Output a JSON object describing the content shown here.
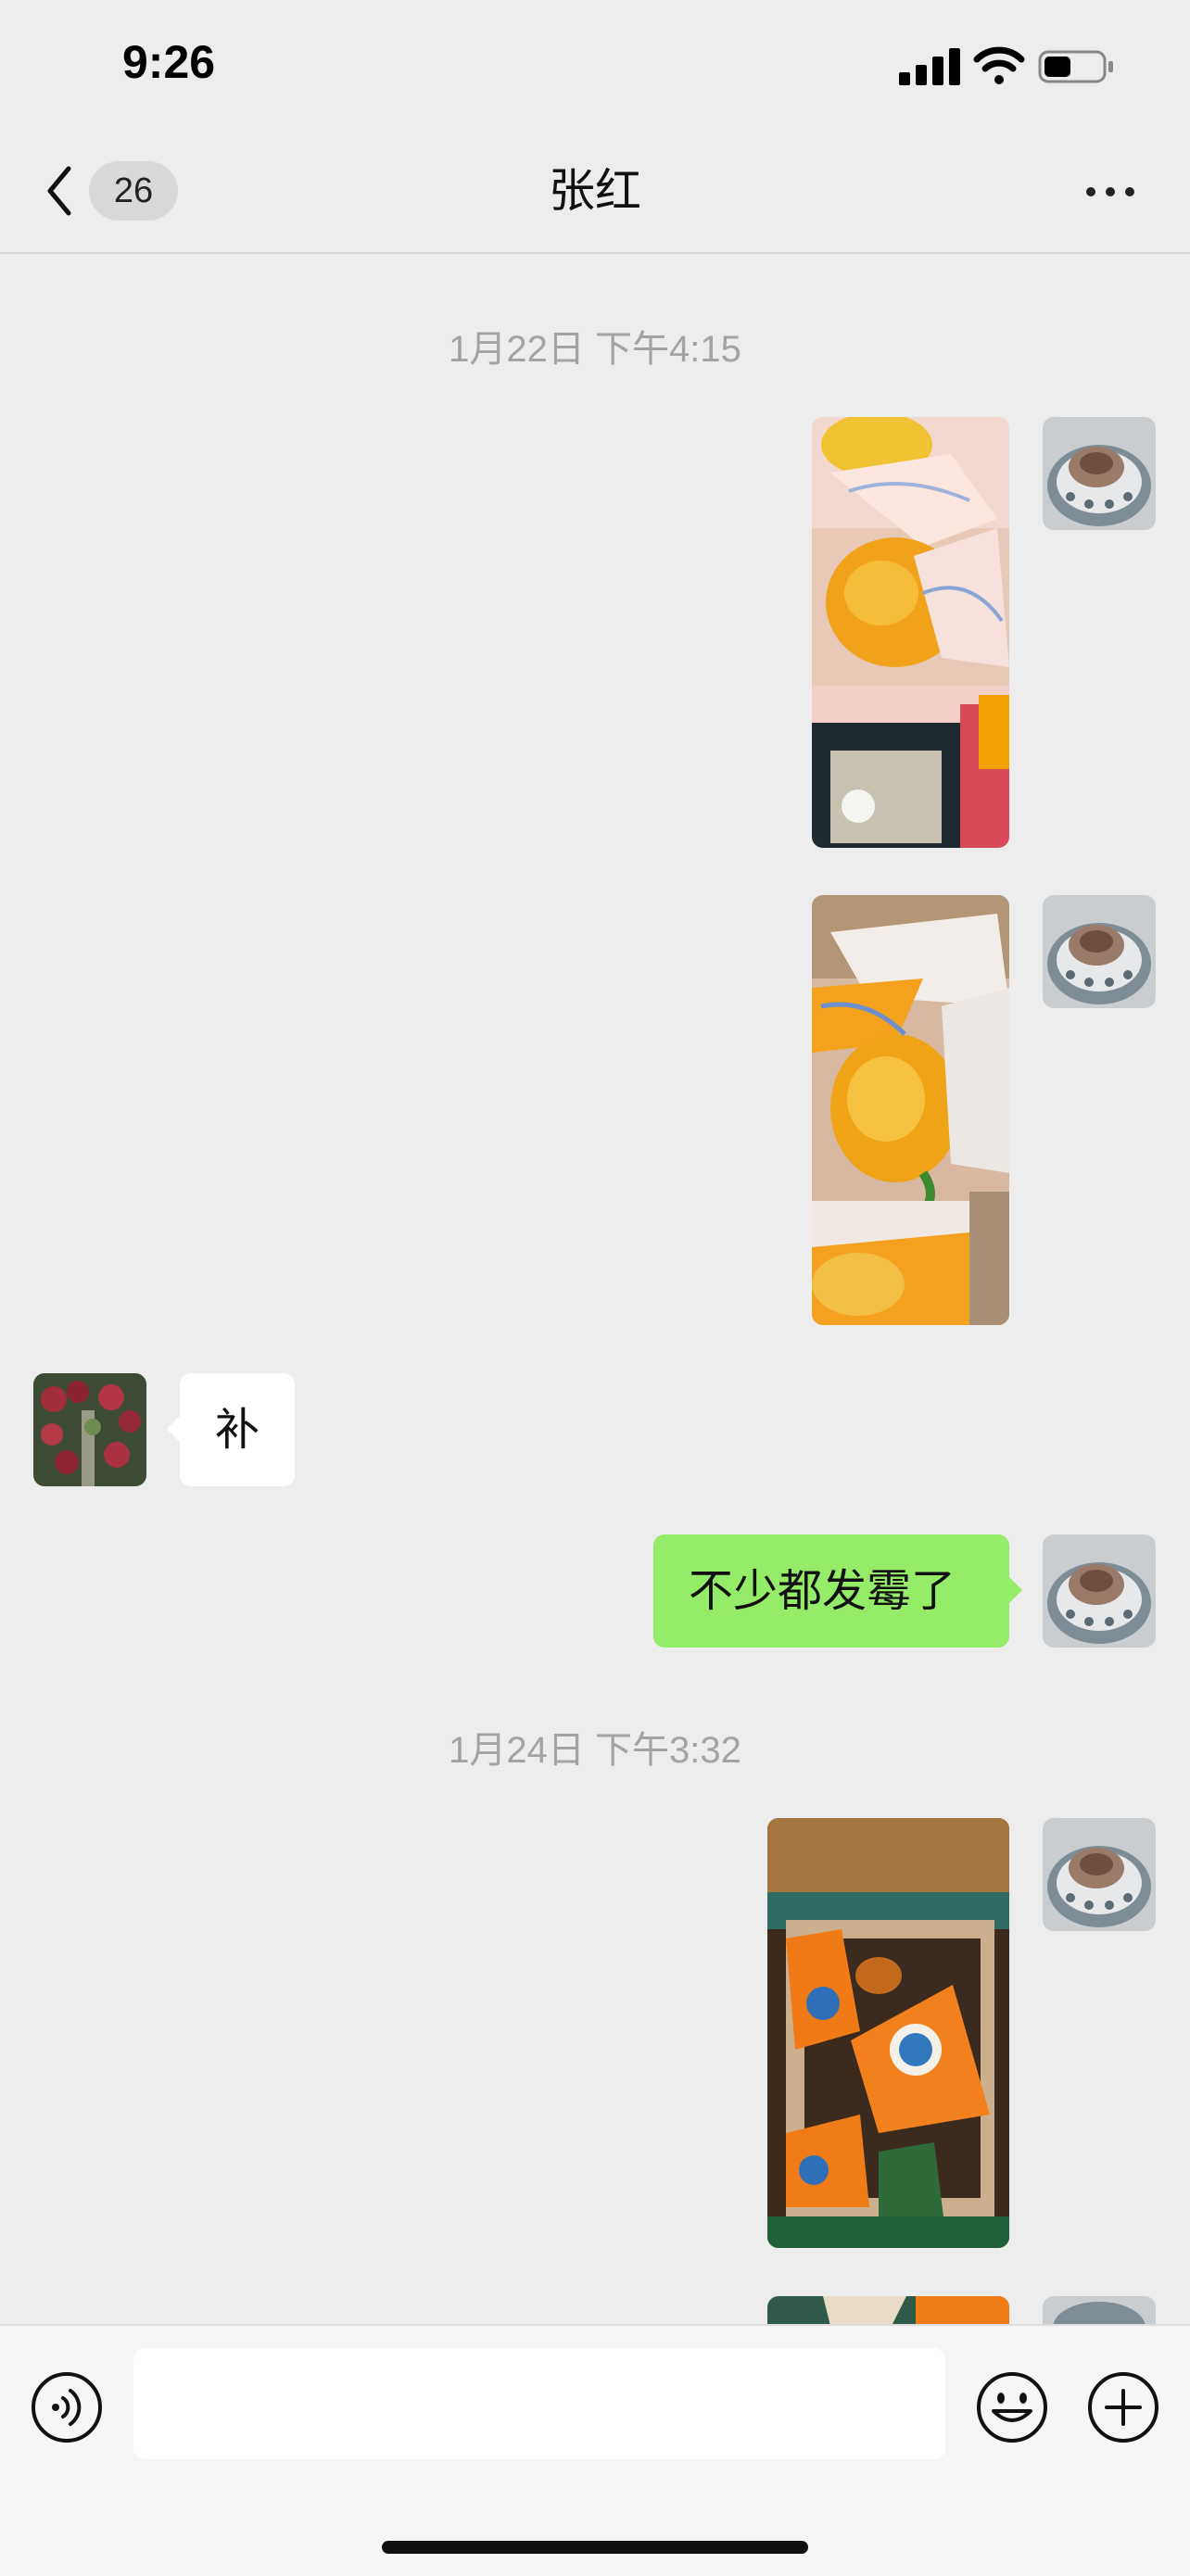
{
  "status_bar": {
    "time": "9:26",
    "signal_icon": "cellular-signal-icon",
    "wifi_icon": "wifi-icon",
    "battery_icon": "battery-icon",
    "battery_level": 0.45
  },
  "nav": {
    "back_icon": "chevron-left-icon",
    "unread_count": "26",
    "title": "张红",
    "more_icon": "more-dots-icon"
  },
  "messages": {
    "ts1": "1月22日 下午4:15",
    "ts2": "1月24日 下午3:32",
    "incoming_text": "补",
    "outgoing_text": "不少都发霉了"
  },
  "input_bar": {
    "voice_icon": "voice-icon",
    "text_value": "",
    "emoji_icon": "emoji-icon",
    "plus_icon": "plus-icon"
  },
  "colors": {
    "background": "#ededed",
    "outgoing_bubble": "#95ec69",
    "incoming_bubble": "#ffffff",
    "timestamp": "#a3a3a3"
  }
}
